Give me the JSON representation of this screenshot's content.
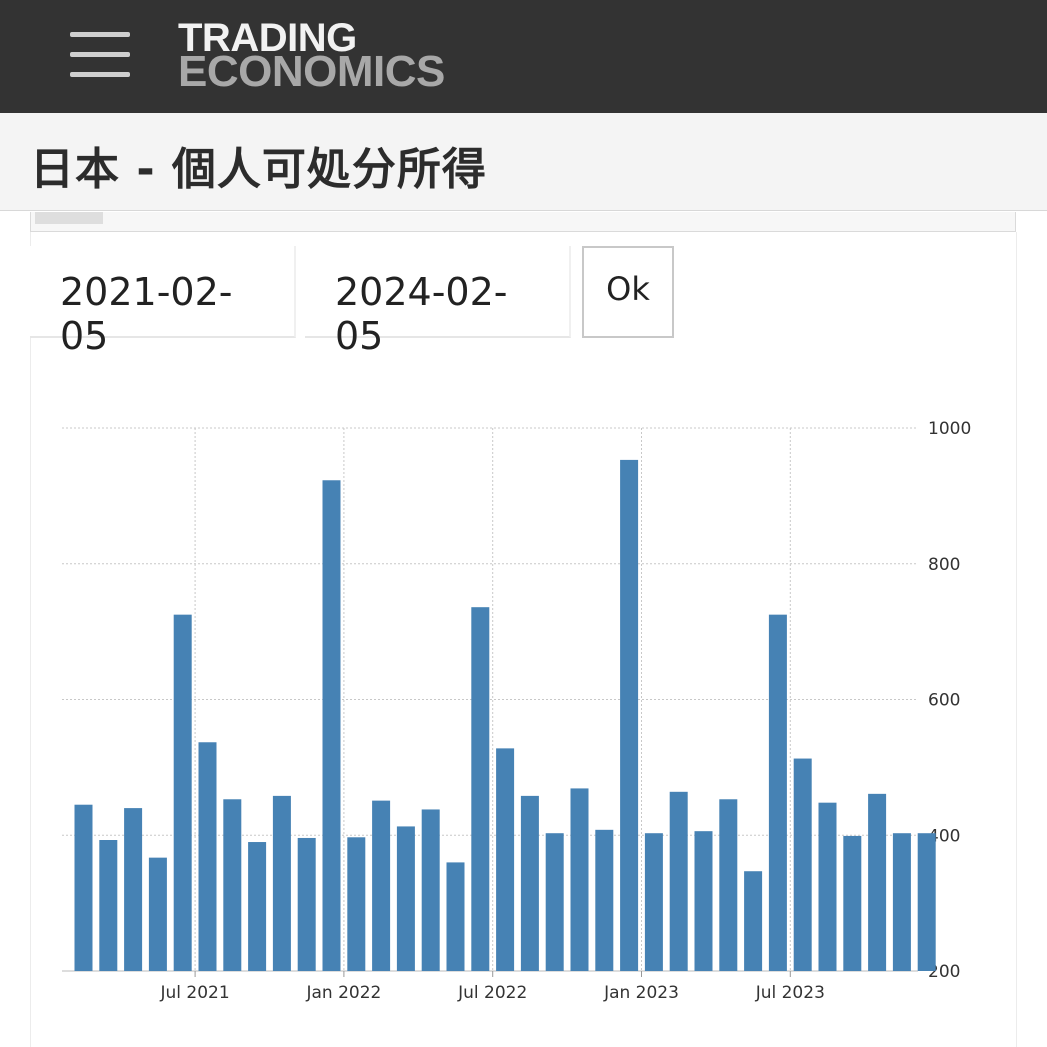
{
  "header": {
    "menu_icon": "hamburger-menu-icon",
    "logo_line1": "TRADING",
    "logo_line2": "ECONOMICS"
  },
  "page": {
    "title": "日本 - 個人可処分所得"
  },
  "filter": {
    "start_date": "2021-02-05",
    "end_date": "2024-02-05",
    "ok_label": "Ok"
  },
  "chart_data": {
    "type": "bar",
    "color": "#4682b4",
    "ylim": [
      200,
      1000
    ],
    "yticks": [
      200,
      400,
      600,
      800,
      1000
    ],
    "xtick_labels": [
      "Jul 2021",
      "Jan 2022",
      "Jul 2022",
      "Jan 2023",
      "Jul 2023"
    ],
    "xtick_positions": [
      5,
      11,
      17,
      23,
      29
    ],
    "grid": true,
    "y_axis_side": "right",
    "categories": [
      "2021-02",
      "2021-03",
      "2021-04",
      "2021-05",
      "2021-06",
      "2021-07",
      "2021-08",
      "2021-09",
      "2021-10",
      "2021-11",
      "2021-12",
      "2022-01",
      "2022-02",
      "2022-03",
      "2022-04",
      "2022-05",
      "2022-06",
      "2022-07",
      "2022-08",
      "2022-09",
      "2022-10",
      "2022-11",
      "2022-12",
      "2023-01",
      "2023-02",
      "2023-03",
      "2023-04",
      "2023-05",
      "2023-06",
      "2023-07",
      "2023-08",
      "2023-09",
      "2023-10",
      "2023-11",
      "2023-12"
    ],
    "values": [
      445,
      393,
      440,
      367,
      725,
      537,
      453,
      390,
      458,
      396,
      923,
      397,
      451,
      413,
      438,
      360,
      736,
      528,
      458,
      403,
      469,
      408,
      953,
      403,
      464,
      406,
      453,
      347,
      725,
      513,
      448,
      399,
      461,
      403,
      403
    ]
  }
}
